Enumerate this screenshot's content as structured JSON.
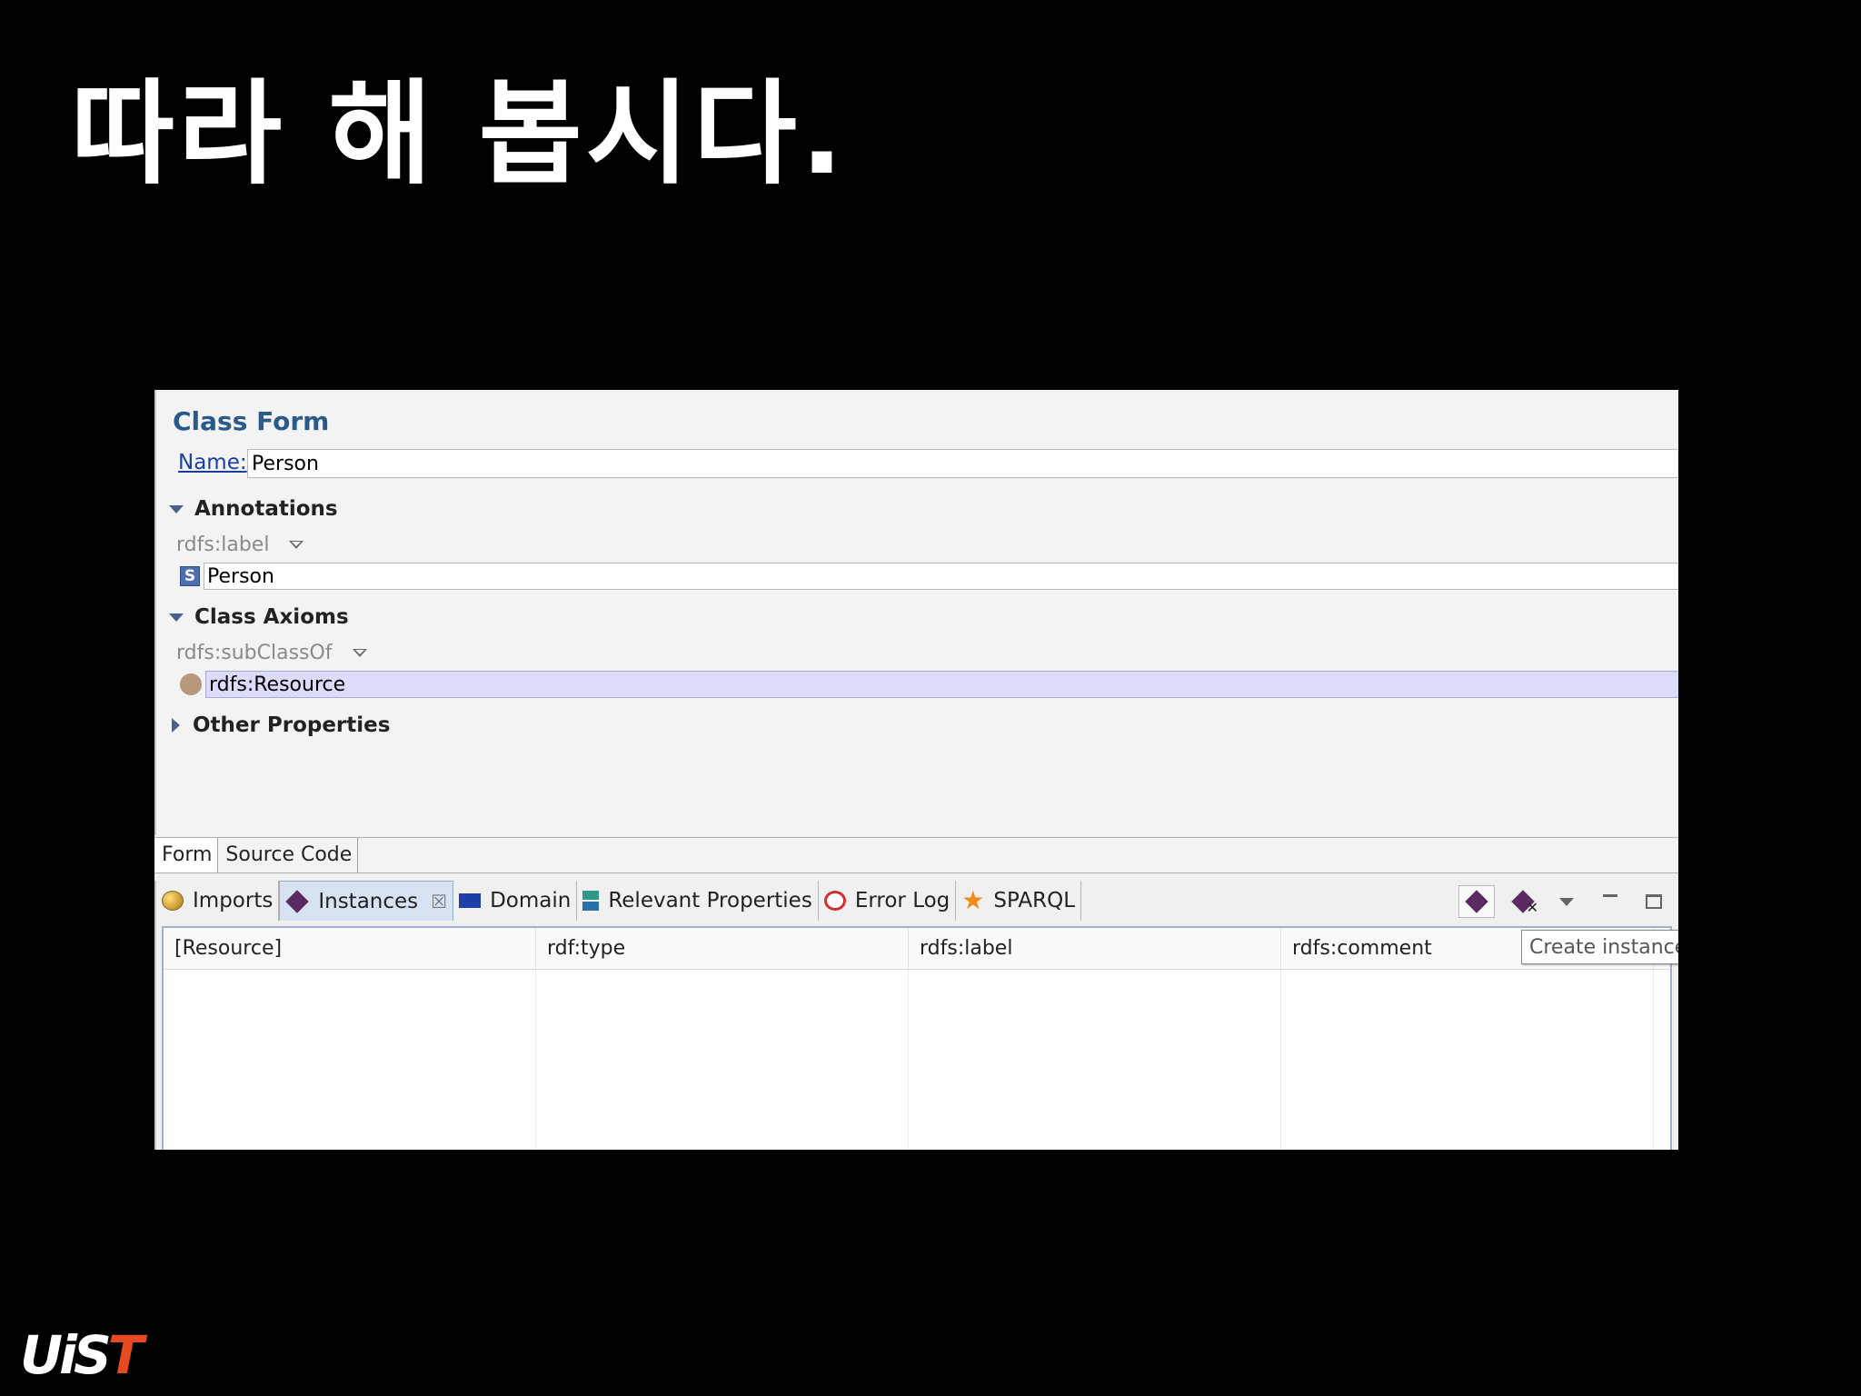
{
  "slide": {
    "title": "따라 해 봅시다."
  },
  "form": {
    "title": "Class Form",
    "name_label": "Name:",
    "name_value": "Person",
    "sections": {
      "annotations": "Annotations",
      "class_axioms": "Class Axioms",
      "other_properties": "Other Properties"
    },
    "annotation_prop": "rdfs:label",
    "annotation_type_icon": "S",
    "annotation_value": "Person",
    "axiom_prop": "rdfs:subClassOf",
    "axiom_value": "rdfs:Resource",
    "tabs": [
      "Form",
      "Source Code"
    ]
  },
  "views": {
    "tabs": [
      {
        "label": "Imports",
        "icon": "imports-icon"
      },
      {
        "label": "Instances",
        "icon": "instance-diamond-icon",
        "active": true
      },
      {
        "label": "Domain",
        "icon": "domain-icon"
      },
      {
        "label": "Relevant Properties",
        "icon": "relevant-properties-icon"
      },
      {
        "label": "Error Log",
        "icon": "error-log-icon"
      },
      {
        "label": "SPARQL",
        "icon": "sparql-star-icon"
      }
    ],
    "close_glyph": "☒",
    "tooltip": "Create instance",
    "columns": [
      "[Resource]",
      "rdf:type",
      "rdfs:label",
      "rdfs:comment"
    ]
  },
  "logo": {
    "part1": "Ui",
    "part2": "S",
    "part3": "T"
  },
  "colors": {
    "form_title": "#2a5a8a",
    "selection": "#dcdcfa",
    "active_tab": "#d7e3f3",
    "instance_icon": "#5b2a63",
    "logo_accent": "#e64a1e"
  }
}
